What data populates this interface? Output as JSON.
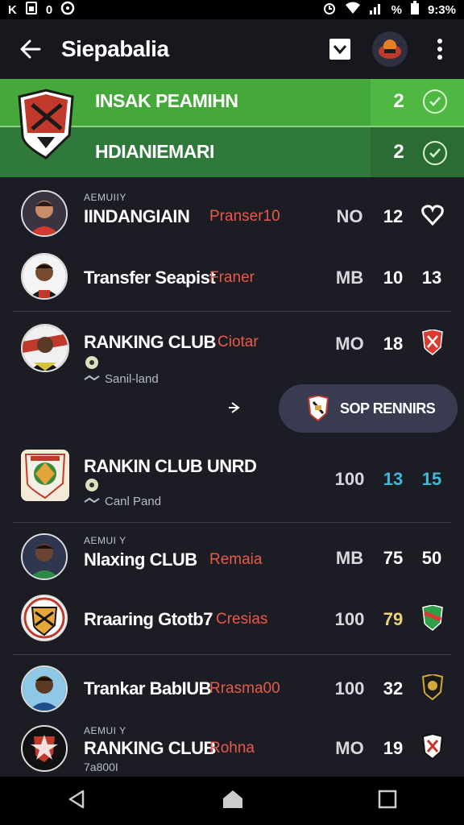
{
  "status_bar": {
    "left_icons": [
      "K",
      "sim-icon",
      "0",
      "clock-icon"
    ],
    "right_text": "9:3%",
    "percent": "%"
  },
  "app_bar": {
    "title": "Siepabalia"
  },
  "banner": {
    "items": [
      {
        "label": "INSAK PEAMIHN",
        "count": "2"
      },
      {
        "label": "HDIANIEMARI",
        "count": "2"
      }
    ]
  },
  "rows": [
    {
      "kicker": "AEMUIIY",
      "name": "IINDANGIAIN",
      "club": "Pranser10",
      "c1": "NO",
      "c2": "12",
      "c3": "",
      "badge": "heart-icon",
      "c2_color": "#ffffff",
      "c3_color": "#ffffff"
    },
    {
      "kicker": "",
      "name": "Transfer Seapist",
      "club": "Franer",
      "c1": "MB",
      "c2": "10",
      "c3": "13",
      "badge": "",
      "c2_color": "#ffffff",
      "c3_color": "#ffffff"
    },
    {
      "kicker": "",
      "name": "RANKING CLUB",
      "club": "Ciotar",
      "sub": "Sanil-land",
      "c1": "MO",
      "c2": "18",
      "c3": "",
      "badge": "club-badge-red",
      "c2_color": "#ffffff",
      "c3_color": "#ffffff"
    },
    {
      "kicker": "",
      "name": "RANKIN CLUB UNRD",
      "club": "",
      "sub": "Canl Pand",
      "c1": "100",
      "c2": "13",
      "c3": "15",
      "badge": "",
      "c2_color": "#3fb8d8",
      "c3_color": "#3fb8d8"
    },
    {
      "kicker": "AEMUI Y",
      "name": "Nlaxing CLUB",
      "club": "Remaia",
      "c1": "MB",
      "c2": "75",
      "c3": "50",
      "badge": "",
      "c2_color": "#ffffff",
      "c3_color": "#ffffff"
    },
    {
      "kicker": "",
      "name": "Rraaring Gtotb7",
      "club": "Cresias",
      "c1": "100",
      "c2": "79",
      "c3": "",
      "badge": "club-badge-green",
      "c2_color": "#e8d27a",
      "c3_color": "#ffffff"
    },
    {
      "kicker": "",
      "name": "Trankar BabIUB",
      "club": "Rrasma00",
      "c1": "100",
      "c2": "32",
      "c3": "",
      "badge": "club-badge-gold",
      "c2_color": "#ffffff",
      "c3_color": "#ffffff"
    },
    {
      "kicker": "AEMUI Y",
      "name": "RANKING CLUB",
      "club": "Rohna",
      "sub": "7a800I",
      "c1": "MO",
      "c2": "19",
      "c3": "",
      "badge": "club-badge-white",
      "c2_color": "#ffffff",
      "c3_color": "#ffffff"
    }
  ],
  "pill": {
    "label": "SOP RENNIRS"
  },
  "colors": {
    "accent_green": "#45a83a",
    "club_red": "#e8594a",
    "highlight_blue": "#3fb8d8"
  }
}
